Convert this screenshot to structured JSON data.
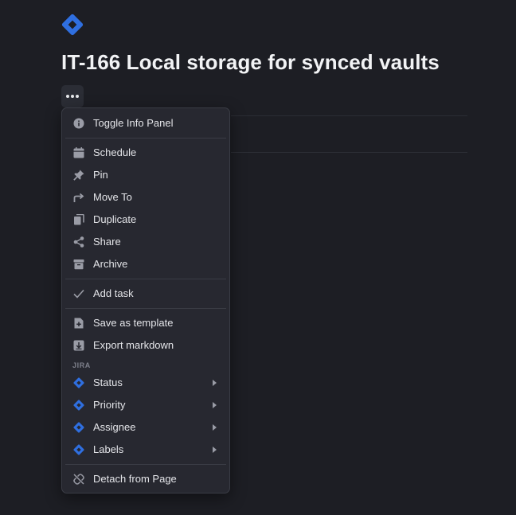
{
  "page": {
    "title": "IT-166 Local storage for synced vaults",
    "logo_icon": "jira-logo-icon",
    "more_button_icon": "ellipsis-icon"
  },
  "colors": {
    "background": "#1d1e24",
    "menu_background": "#272830",
    "menu_border": "#3a3c45",
    "text": "#e4e5e9",
    "icon_gray": "#9a9ca6",
    "jira_blue": "#2f6fe0"
  },
  "menu": {
    "items": [
      {
        "label": "Toggle Info Panel",
        "icon": "info-icon"
      },
      {
        "label": "Schedule",
        "icon": "calendar-icon"
      },
      {
        "label": "Pin",
        "icon": "pin-icon"
      },
      {
        "label": "Move To",
        "icon": "move-arrow-icon"
      },
      {
        "label": "Duplicate",
        "icon": "duplicate-icon"
      },
      {
        "label": "Share",
        "icon": "share-icon"
      },
      {
        "label": "Archive",
        "icon": "archive-icon"
      },
      {
        "label": "Add task",
        "icon": "checkmark-icon"
      },
      {
        "label": "Save as template",
        "icon": "template-icon"
      },
      {
        "label": "Export markdown",
        "icon": "export-icon"
      }
    ],
    "jira_section": {
      "header": "JIRA",
      "items": [
        {
          "label": "Status",
          "icon": "jira-icon",
          "has_submenu": true
        },
        {
          "label": "Priority",
          "icon": "jira-icon",
          "has_submenu": true
        },
        {
          "label": "Assignee",
          "icon": "jira-icon",
          "has_submenu": true
        },
        {
          "label": "Labels",
          "icon": "jira-icon",
          "has_submenu": true
        }
      ]
    },
    "detach": {
      "label": "Detach from Page",
      "icon": "unlink-icon"
    }
  }
}
